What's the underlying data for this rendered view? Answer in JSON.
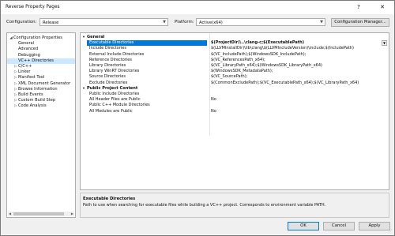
{
  "window": {
    "title": "Reverse Property Pages",
    "help_glyph": "?",
    "close_glyph": "✕"
  },
  "config_row": {
    "configuration_label": "Configuration:",
    "configuration_value": "Release",
    "platform_label": "Platform:",
    "platform_value": "Active(x64)",
    "config_manager_label": "Configuration Manager..."
  },
  "tree": {
    "items": [
      {
        "label": "Configuration Properties",
        "expander": "◢",
        "indent": 0,
        "selected": false
      },
      {
        "label": "General",
        "expander": "",
        "indent": 1,
        "selected": false
      },
      {
        "label": "Advanced",
        "expander": "",
        "indent": 1,
        "selected": false
      },
      {
        "label": "Debugging",
        "expander": "",
        "indent": 1,
        "selected": false
      },
      {
        "label": "VC++ Directories",
        "expander": "",
        "indent": 1,
        "selected": true
      },
      {
        "label": "C/C++",
        "expander": "▷",
        "indent": 1,
        "selected": false
      },
      {
        "label": "Linker",
        "expander": "▷",
        "indent": 1,
        "selected": false
      },
      {
        "label": "Manifest Tool",
        "expander": "▷",
        "indent": 1,
        "selected": false
      },
      {
        "label": "XML Document Generator",
        "expander": "▷",
        "indent": 1,
        "selected": false
      },
      {
        "label": "Browse Information",
        "expander": "▷",
        "indent": 1,
        "selected": false
      },
      {
        "label": "Build Events",
        "expander": "▷",
        "indent": 1,
        "selected": false
      },
      {
        "label": "Custom Build Step",
        "expander": "▷",
        "indent": 1,
        "selected": false
      },
      {
        "label": "Code Analysis",
        "expander": "▷",
        "indent": 1,
        "selected": false
      }
    ]
  },
  "grid": {
    "general_label": "General",
    "public_label": "Public Project Content",
    "general_rows": [
      {
        "name": "Executable Directories",
        "value": "$(ProjectDir)\\..\\clang-c;$(ExecutablePath)",
        "selected": true
      },
      {
        "name": "Include Directories",
        "value": "$(LLVMInstallDir)\\lib\\clang\\$(LLVMIncludeVersion)\\include;$(IncludePath)",
        "selected": false
      },
      {
        "name": "External Include Directories",
        "value": "$(VC_IncludePath);$(WindowsSDK_IncludePath);",
        "selected": false
      },
      {
        "name": "Reference Directories",
        "value": "$(VC_ReferencesPath_x64);",
        "selected": false
      },
      {
        "name": "Library Directories",
        "value": "$(VC_LibraryPath_x64);$(WindowsSDK_LibraryPath_x64)",
        "selected": false
      },
      {
        "name": "Library WinRT Directories",
        "value": "$(WindowsSDK_MetadataPath);",
        "selected": false
      },
      {
        "name": "Source Directories",
        "value": "$(VC_SourcePath);",
        "selected": false
      },
      {
        "name": "Exclude Directories",
        "value": "$(CommonExcludePath);$(VC_ExecutablePath_x64);$(VC_LibraryPath_x64)",
        "selected": false
      }
    ],
    "public_rows": [
      {
        "name": "Public Include Directories",
        "value": ""
      },
      {
        "name": "All Header Files are Public",
        "value": "No"
      },
      {
        "name": "Public C++ Module Directories",
        "value": ""
      },
      {
        "name": "All Modules are Public",
        "value": "No"
      }
    ]
  },
  "description": {
    "title": "Executable Directories",
    "text": "Path to use when searching for executable files while building a VC++ project.  Corresponds to environment variable PATH."
  },
  "buttons": {
    "ok": "OK",
    "cancel": "Cancel",
    "apply": "Apply"
  }
}
